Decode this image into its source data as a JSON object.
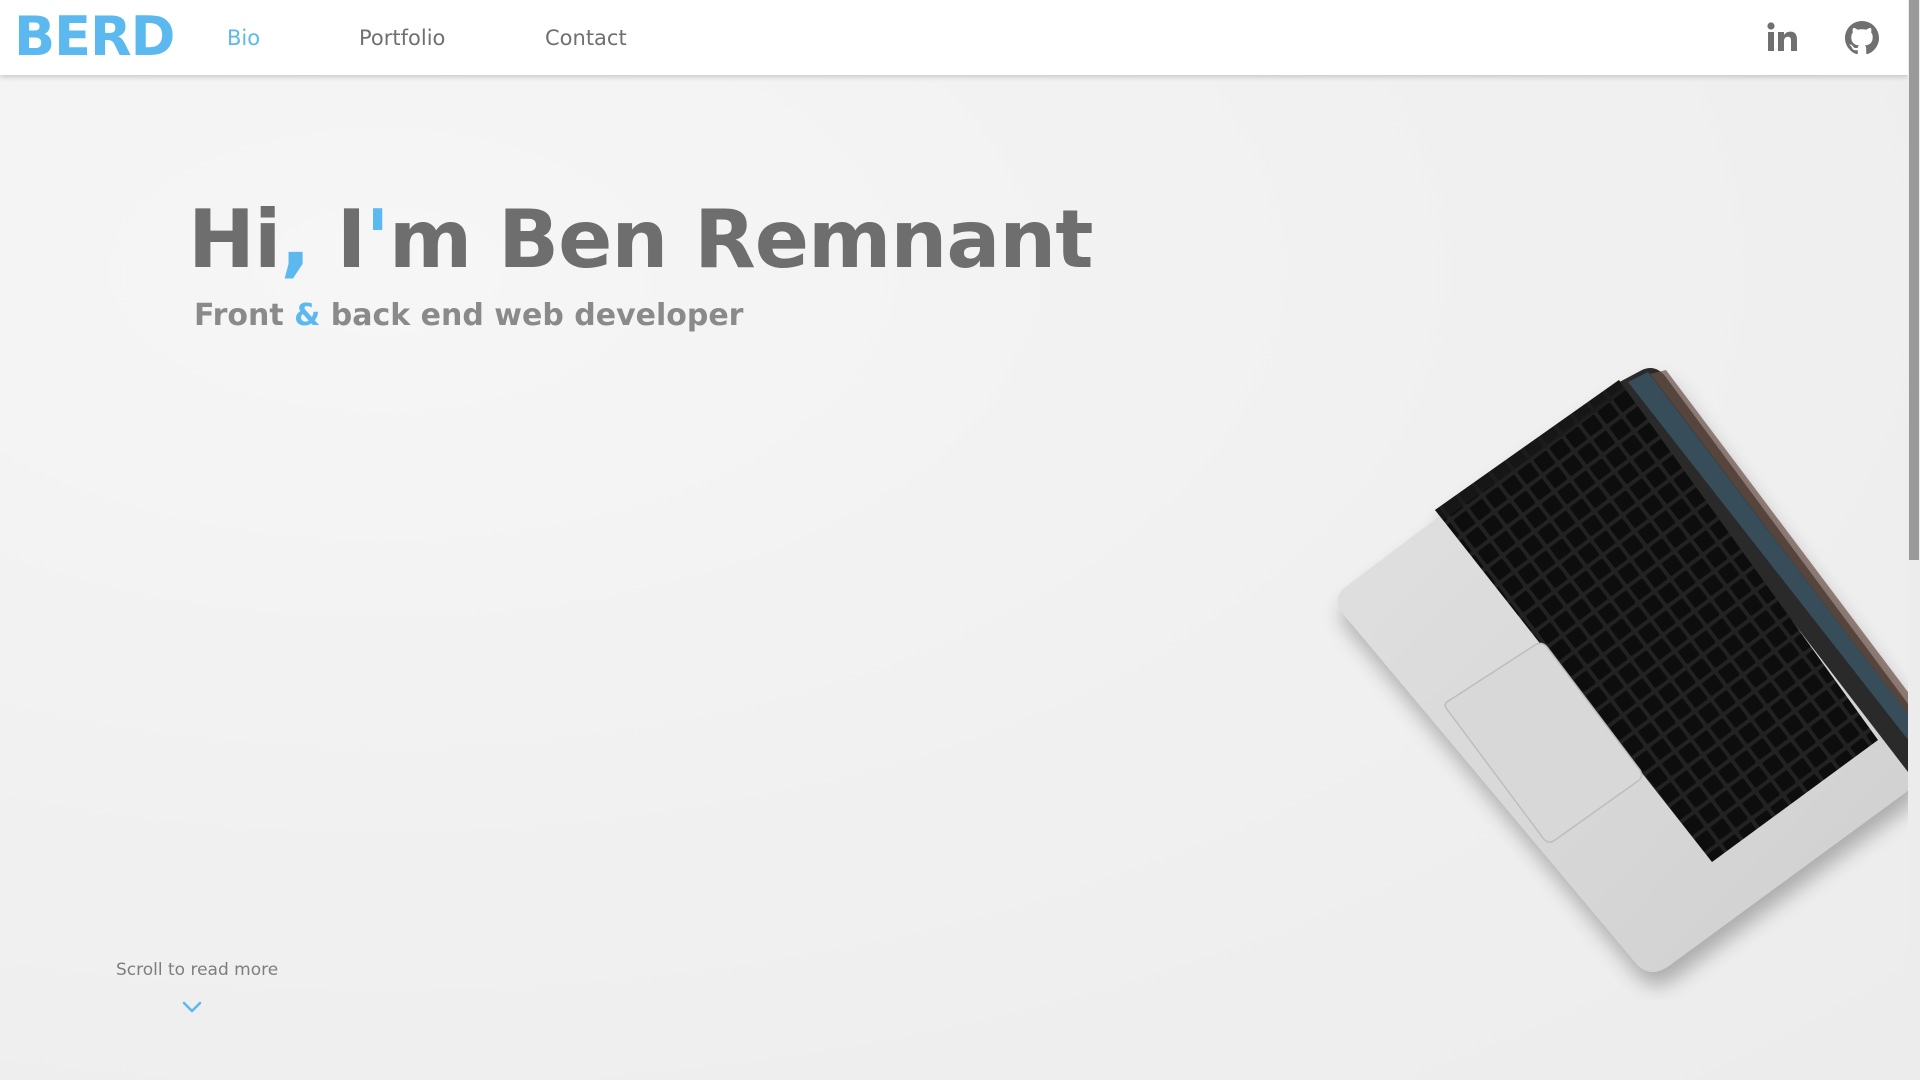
{
  "header": {
    "logo": "BERD",
    "nav": [
      {
        "label": "Bio",
        "active": true
      },
      {
        "label": "Portfolio",
        "active": false
      },
      {
        "label": "Contact",
        "active": false
      }
    ],
    "social": [
      {
        "icon": "linkedin-icon"
      },
      {
        "icon": "github-icon"
      }
    ]
  },
  "hero": {
    "title_part1": "Hi",
    "title_comma": ",",
    "title_part2": " I",
    "title_apostrophe": "'",
    "title_part3": "m Ben Remnant",
    "subtitle_part1": "Front ",
    "subtitle_amp": "&",
    "subtitle_part2": " back end web developer"
  },
  "scroll": {
    "label": "Scroll to read more",
    "icon": "chevron-down-icon"
  },
  "decor": {
    "image": "laptop-image"
  },
  "colors": {
    "accent": "#5bb9f0",
    "text": "#6e6e6e",
    "subtext": "#8a8a8a",
    "header_bg": "#ffffff"
  }
}
